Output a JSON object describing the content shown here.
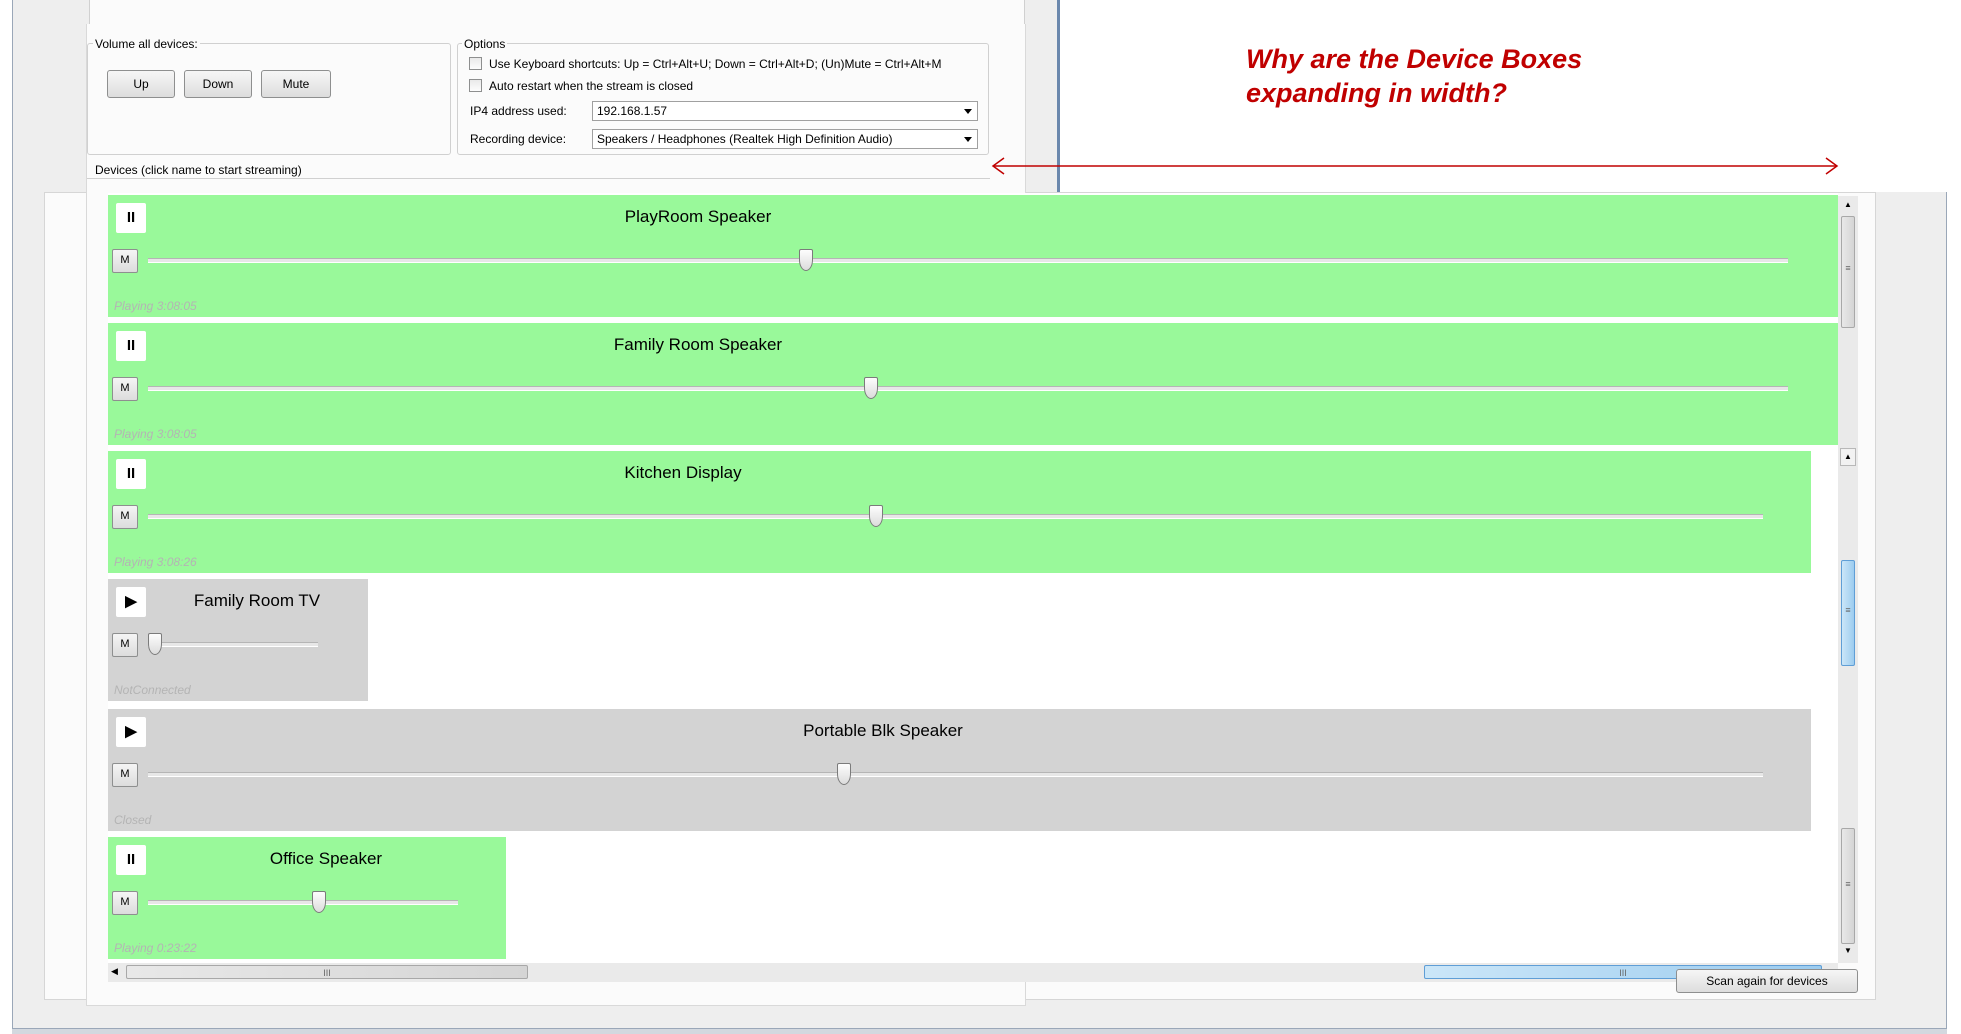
{
  "volume_group": {
    "label": "Volume all devices:",
    "up": "Up",
    "down": "Down",
    "mute": "Mute"
  },
  "options": {
    "label": "Options",
    "keyboard_shortcuts": "Use Keyboard shortcuts: Up = Ctrl+Alt+U; Down = Ctrl+Alt+D; (Un)Mute = Ctrl+Alt+M",
    "auto_restart": "Auto restart when the stream is closed",
    "ip_label": "IP4 address used:",
    "ip_value": "192.168.1.57",
    "recording_label": "Recording device:",
    "recording_value": "Speakers / Headphones (Realtek High Definition Audio)"
  },
  "devices_group_label": "Devices (click name to start streaming)",
  "annotation": "Why are the Device Boxes expanding in width?",
  "devices": [
    {
      "name": "PlayRoom Speaker",
      "control": "II",
      "mute": "M",
      "status": "Playing 3:08:05",
      "state": "playing",
      "volume": 0.4
    },
    {
      "name": "Family Room Speaker",
      "control": "II",
      "mute": "M",
      "status": "Playing 3:08:05",
      "state": "playing",
      "volume": 0.44
    },
    {
      "name": "Kitchen Display",
      "control": "II",
      "mute": "M",
      "status": "Playing 3:08:26",
      "state": "playing",
      "volume": 0.45
    },
    {
      "name": "Family Room TV",
      "control": "▶",
      "mute": "M",
      "status": "NotConnected",
      "state": "not-connected",
      "volume": 0.0
    },
    {
      "name": "Portable Blk Speaker",
      "control": "▶",
      "mute": "M",
      "status": "Closed",
      "state": "closed",
      "volume": 0.43
    },
    {
      "name": "Office Speaker",
      "control": "II",
      "mute": "M",
      "status": "Playing 0:23:22",
      "state": "playing",
      "volume": 0.55
    }
  ],
  "scrollbar_grip": "≡",
  "hscroll_grip": "III",
  "scan_button": "Scan again for devices",
  "colors": {
    "playing": "#99f99a",
    "idle": "#d3d3d3",
    "annotation": "#c00000"
  }
}
